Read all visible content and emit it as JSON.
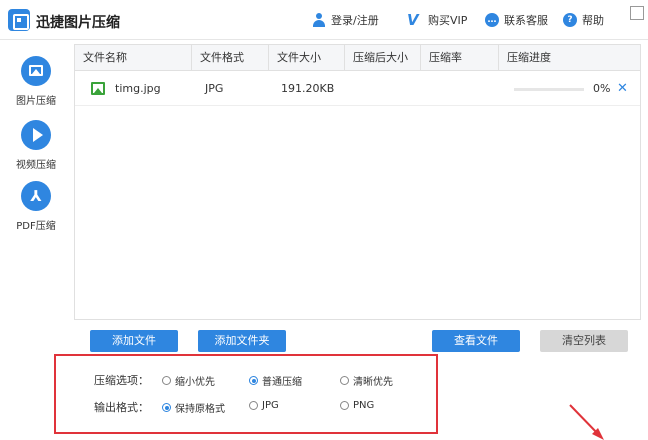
{
  "app": {
    "title": "迅捷图片压缩"
  },
  "toolbar": {
    "login_label": "登录/注册",
    "vip_label": "购买VIP",
    "service_label": "联系客服",
    "help_label": "帮助",
    "icons": [
      "user-icon",
      "vip-icon",
      "chat-icon",
      "help-icon"
    ]
  },
  "sidebar": {
    "items": [
      {
        "label": "图片压缩",
        "icon": "image-icon"
      },
      {
        "label": "视频压缩",
        "icon": "play-icon"
      },
      {
        "label": "PDF压缩",
        "icon": "pdf-icon"
      }
    ]
  },
  "table": {
    "columns": [
      "文件名称",
      "文件格式",
      "文件大小",
      "压缩后大小",
      "压缩率",
      "压缩进度"
    ],
    "rows": [
      {
        "name": "timg.jpg",
        "format": "JPG",
        "size": "191.20KB",
        "compressed_size": "",
        "ratio": "",
        "progress_text": "0%",
        "progress": 0
      }
    ]
  },
  "actions": {
    "add_file": "添加文件",
    "add_folder": "添加文件夹",
    "view_files": "查看文件",
    "clear_list": "清空列表"
  },
  "options": {
    "compress_label": "压缩选项：",
    "compress_choices": [
      "缩小优先",
      "普通压缩",
      "清晰优先"
    ],
    "compress_selected": "普通压缩",
    "format_label": "输出格式：",
    "format_choices": [
      "保持原格式",
      "JPG",
      "PNG"
    ],
    "format_selected": "保持原格式"
  },
  "colors": {
    "accent": "#2f86e0",
    "highlight": "#e0333a",
    "file_icon": "#3aa33a"
  }
}
